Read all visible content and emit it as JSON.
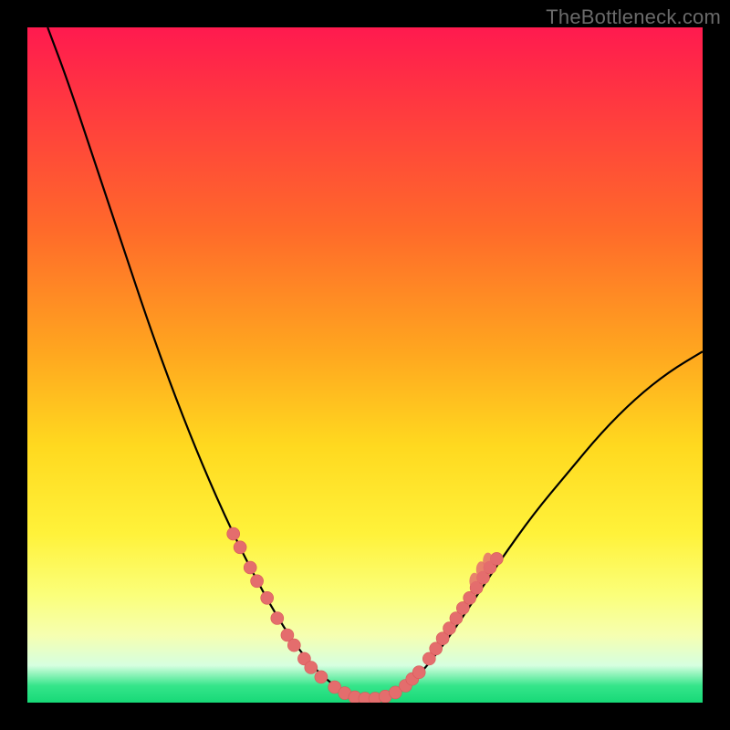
{
  "watermark": "TheBottleneck.com",
  "colors": {
    "curve_stroke": "#000000",
    "marker_fill": "#e46d6d",
    "marker_stroke": "#d85858",
    "frame_bg": "#000000",
    "gradient_stops": [
      {
        "offset": 0.0,
        "color": "#ff1a4f"
      },
      {
        "offset": 0.12,
        "color": "#ff3a3f"
      },
      {
        "offset": 0.3,
        "color": "#ff6a2a"
      },
      {
        "offset": 0.48,
        "color": "#ffa61f"
      },
      {
        "offset": 0.62,
        "color": "#ffd91f"
      },
      {
        "offset": 0.75,
        "color": "#fff23a"
      },
      {
        "offset": 0.84,
        "color": "#fbff7a"
      },
      {
        "offset": 0.9,
        "color": "#f6ffb0"
      },
      {
        "offset": 0.945,
        "color": "#d6ffe0"
      },
      {
        "offset": 0.975,
        "color": "#35e58a"
      },
      {
        "offset": 1.0,
        "color": "#17d977"
      }
    ]
  },
  "chart_data": {
    "type": "line",
    "title": "",
    "xlabel": "",
    "ylabel": "",
    "xlim": [
      0,
      100
    ],
    "ylim": [
      0,
      100
    ],
    "curve": [
      {
        "x": 3,
        "y": 100
      },
      {
        "x": 6,
        "y": 92
      },
      {
        "x": 10,
        "y": 80
      },
      {
        "x": 14,
        "y": 68
      },
      {
        "x": 18,
        "y": 56
      },
      {
        "x": 22,
        "y": 45
      },
      {
        "x": 26,
        "y": 35
      },
      {
        "x": 30,
        "y": 26
      },
      {
        "x": 34,
        "y": 18
      },
      {
        "x": 38,
        "y": 11
      },
      {
        "x": 42,
        "y": 5.5
      },
      {
        "x": 46,
        "y": 2
      },
      {
        "x": 49,
        "y": 0.6
      },
      {
        "x": 52,
        "y": 0.5
      },
      {
        "x": 55,
        "y": 1.4
      },
      {
        "x": 58,
        "y": 4
      },
      {
        "x": 62,
        "y": 9
      },
      {
        "x": 66,
        "y": 15
      },
      {
        "x": 70,
        "y": 21
      },
      {
        "x": 75,
        "y": 28
      },
      {
        "x": 80,
        "y": 34
      },
      {
        "x": 85,
        "y": 40
      },
      {
        "x": 90,
        "y": 45
      },
      {
        "x": 95,
        "y": 49
      },
      {
        "x": 100,
        "y": 52
      }
    ],
    "markers_left": [
      {
        "x": 30.5,
        "y": 25
      },
      {
        "x": 31.5,
        "y": 23
      },
      {
        "x": 33.0,
        "y": 20
      },
      {
        "x": 34.0,
        "y": 18
      },
      {
        "x": 35.5,
        "y": 15.5
      },
      {
        "x": 37.0,
        "y": 12.5
      },
      {
        "x": 38.5,
        "y": 10
      },
      {
        "x": 39.5,
        "y": 8.5
      },
      {
        "x": 41.0,
        "y": 6.5
      },
      {
        "x": 42.0,
        "y": 5.2
      },
      {
        "x": 43.5,
        "y": 3.8
      },
      {
        "x": 45.5,
        "y": 2.3
      },
      {
        "x": 47.0,
        "y": 1.4
      }
    ],
    "markers_bottom": [
      {
        "x": 48.5,
        "y": 0.8
      },
      {
        "x": 50.0,
        "y": 0.6
      },
      {
        "x": 51.5,
        "y": 0.6
      },
      {
        "x": 53.0,
        "y": 0.9
      },
      {
        "x": 54.5,
        "y": 1.5
      }
    ],
    "markers_right": [
      {
        "x": 56.0,
        "y": 2.5
      },
      {
        "x": 57.0,
        "y": 3.5
      },
      {
        "x": 58.0,
        "y": 4.5
      },
      {
        "x": 59.5,
        "y": 6.5
      },
      {
        "x": 60.5,
        "y": 8.0
      },
      {
        "x": 61.5,
        "y": 9.5
      },
      {
        "x": 62.5,
        "y": 11.0
      },
      {
        "x": 63.5,
        "y": 12.5
      },
      {
        "x": 64.5,
        "y": 14.0
      },
      {
        "x": 65.5,
        "y": 15.5
      },
      {
        "x": 66.5,
        "y": 17.0
      },
      {
        "x": 67.5,
        "y": 18.5
      },
      {
        "x": 68.5,
        "y": 20.0
      },
      {
        "x": 69.5,
        "y": 21.3
      }
    ]
  }
}
